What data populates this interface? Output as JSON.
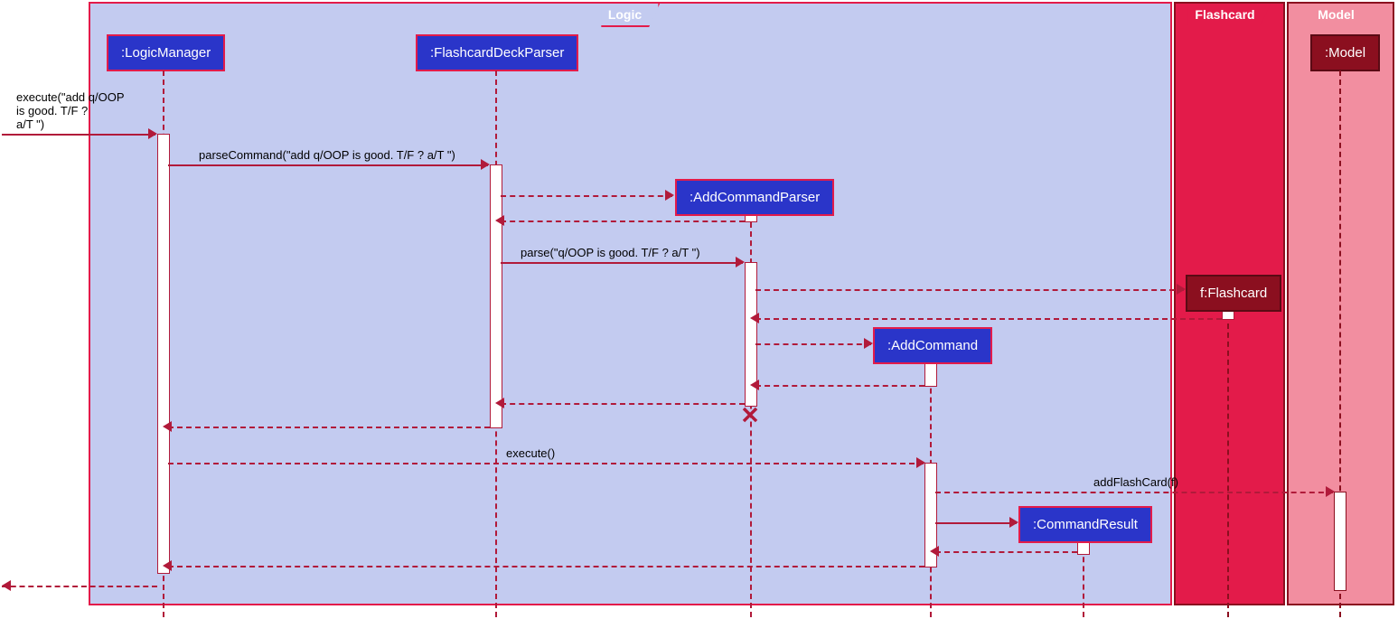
{
  "frames": {
    "logic": {
      "label": "Logic",
      "bg": "#c3cbf0",
      "border": "#e31b4a",
      "labelbg": "#c3cbf0",
      "labelcolor": "#fff"
    },
    "flashcard": {
      "label": "Flashcard",
      "bg": "#e31b4a",
      "border": "#8b0f1f",
      "labelbg": "#e31b4a",
      "labelcolor": "#fff"
    },
    "model": {
      "label": "Model",
      "bg": "#f28ea0",
      "border": "#8b0f1f",
      "labelbg": "#f28ea0",
      "labelcolor": "#fff"
    }
  },
  "participants": {
    "logicManager": {
      "label": ":LogicManager",
      "bg": "#2a35c9",
      "fg": "#fff",
      "border": "#e31b4a"
    },
    "flashcardDeckParser": {
      "label": ":FlashcardDeckParser",
      "bg": "#2a35c9",
      "fg": "#fff",
      "border": "#e31b4a"
    },
    "addCommandParser": {
      "label": ":AddCommandParser",
      "bg": "#2a35c9",
      "fg": "#fff",
      "border": "#e31b4a"
    },
    "addCommand": {
      "label": ":AddCommand",
      "bg": "#2a35c9",
      "fg": "#fff",
      "border": "#e31b4a"
    },
    "commandResult": {
      "label": ":CommandResult",
      "bg": "#2a35c9",
      "fg": "#fff",
      "border": "#e31b4a"
    },
    "flashcardObj": {
      "label": "f:Flashcard",
      "bg": "#8b0f1f",
      "fg": "#fff",
      "border": "#5a0a14"
    },
    "modelObj": {
      "label": ":Model",
      "bg": "#8b0f1f",
      "fg": "#fff",
      "border": "#5a0a14"
    }
  },
  "messages": {
    "m1": "execute(\"add q/OOP\nis good. T/F ?\na/T \")",
    "m2": "parseCommand(\"add q/OOP is good. T/F ? a/T \")",
    "m3": "parse(\"q/OOP is good. T/F ? a/T \")",
    "m4": "execute()",
    "m5": "addFlashCard(f)"
  },
  "colors": {
    "arrow": "#b11a3a",
    "activationFill": "#fff"
  }
}
